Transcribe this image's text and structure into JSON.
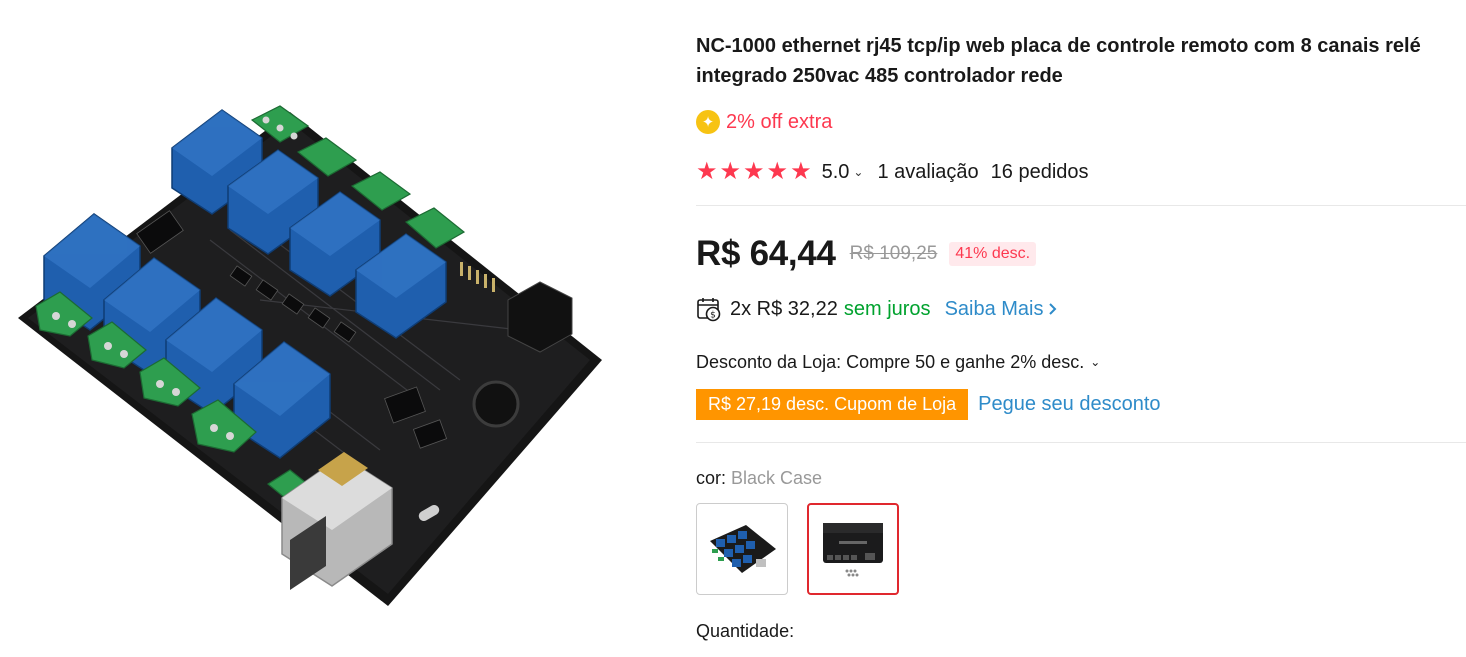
{
  "product": {
    "title": "NC-1000 ethernet rj45 tcp/ip web placa de controle remoto com 8 canais relé integrado 250vac 485 controlador rede",
    "main_image_icon": "relay-board-photo"
  },
  "promo": {
    "icon": "coin-icon",
    "text": "2% off extra"
  },
  "rating": {
    "stars": 5,
    "score": "5.0",
    "reviews": "1 avaliação",
    "orders": "16 pedidos"
  },
  "price": {
    "current": "R$ 64,44",
    "original": "R$ 109,25",
    "discount": "41% desc."
  },
  "installment": {
    "icon": "calendar-money-icon",
    "amount": "2x R$ 32,22",
    "interest": "sem juros",
    "more": "Saiba Mais"
  },
  "store_discount": {
    "text": "Desconto da Loja: Compre 50 e ganhe 2% desc."
  },
  "coupon": {
    "label": "R$ 27,19 desc. Cupom de Loja",
    "link": "Pegue seu desconto"
  },
  "color": {
    "label": "cor:",
    "selected": "Black Case",
    "options": [
      "relay-board-thumbnail",
      "black-case-thumbnail"
    ]
  },
  "quantity": {
    "label": "Quantidade:"
  },
  "colors": {
    "accent_red": "#fd384f",
    "green": "#00a22e",
    "link_blue": "#2e8bc9",
    "coupon_orange": "#ff9500",
    "selected_border": "#e0282e"
  }
}
